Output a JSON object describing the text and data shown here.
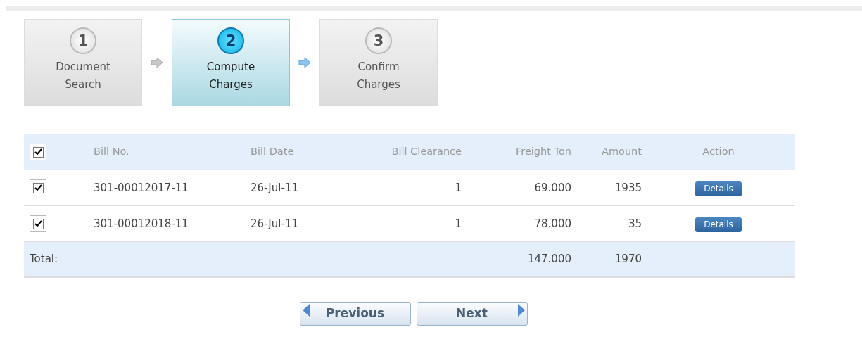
{
  "steps": [
    {
      "number": "1",
      "label": "Document Search",
      "selected": false
    },
    {
      "number": "2",
      "label": "Compute Charges",
      "selected": true
    },
    {
      "number": "3",
      "label": "Confirm Charges",
      "selected": false
    }
  ],
  "table": {
    "header_checked": true,
    "columns": [
      "Bill No.",
      "Bill Date",
      "Bill Clearance",
      "Freight Ton",
      "Amount",
      "Action"
    ],
    "rows": [
      {
        "checked": true,
        "bill_no": "301-00012017-11",
        "bill_date": "26-Jul-11",
        "bill_clearance": "1",
        "freight_ton": "69.000",
        "amount": "1935",
        "action": "Details"
      },
      {
        "checked": true,
        "bill_no": "301-00012018-11",
        "bill_date": "26-Jul-11",
        "bill_clearance": "1",
        "freight_ton": "78.000",
        "amount": "35",
        "action": "Details"
      }
    ],
    "total": {
      "label": "Total:",
      "freight_ton": "147.000",
      "amount": "1970"
    }
  },
  "buttons": [
    {
      "kind": "previous",
      "label": "Previous"
    },
    {
      "kind": "next",
      "label": "Next"
    }
  ]
}
